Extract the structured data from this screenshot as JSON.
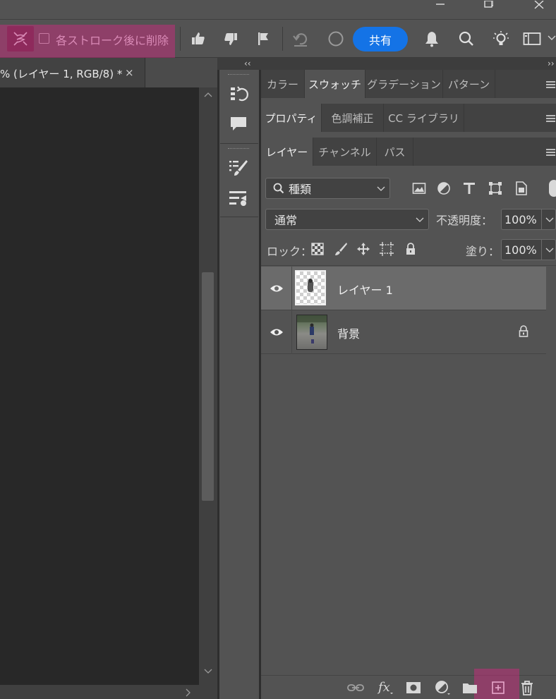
{
  "colors": {
    "accent_share": "#1473e6",
    "highlight_pink": "#d62882",
    "panel_bg": "#535353",
    "canvas_bg": "#282828"
  },
  "window": {
    "minimize_icon": "minimize-icon",
    "restore_icon": "restore-icon",
    "close_icon": "close-icon"
  },
  "options_bar": {
    "tool_icon": "stroke-tool-icon",
    "checkbox_label": "各ストローク後に削除",
    "checkbox_checked": false,
    "share_label": "共有",
    "icons": [
      "thumbs-up-icon",
      "thumbs-down-icon",
      "flag-icon",
      "undo-icon",
      "circle-icon",
      "bell-icon",
      "search-icon",
      "lightbulb-icon",
      "workspace-icon",
      "chevron-down-icon"
    ]
  },
  "document": {
    "tab_label": "% (レイヤー 1, RGB/8) *",
    "tab_close": "×"
  },
  "panels": {
    "collapse_left": "‹‹",
    "collapse_right": "››",
    "row1_tabs": [
      {
        "label": "カラー",
        "active": false
      },
      {
        "label": "スウォッチ",
        "active": true
      },
      {
        "label": "グラデーション",
        "active": false
      },
      {
        "label": "パターン",
        "active": false
      }
    ],
    "row2_tabs": [
      {
        "label": "プロパティ",
        "active": true
      },
      {
        "label": "色調補正",
        "active": false
      },
      {
        "label": "CC ライブラリ",
        "active": false
      }
    ],
    "row3_tabs": [
      {
        "label": "レイヤー",
        "active": true
      },
      {
        "label": "チャンネル",
        "active": false
      },
      {
        "label": "パス",
        "active": false
      }
    ]
  },
  "layers_panel": {
    "filter_kind": "種類",
    "blend_mode": "通常",
    "opacity_label": "不透明度：",
    "opacity_value": "100%",
    "lock_label": "ロック：",
    "fill_label": "塗り：",
    "fill_value": "100%",
    "layers": [
      {
        "name": "レイヤー 1",
        "selected": true,
        "visible": true,
        "locked": false
      },
      {
        "name": "背景",
        "selected": false,
        "visible": true,
        "locked": true
      }
    ]
  }
}
